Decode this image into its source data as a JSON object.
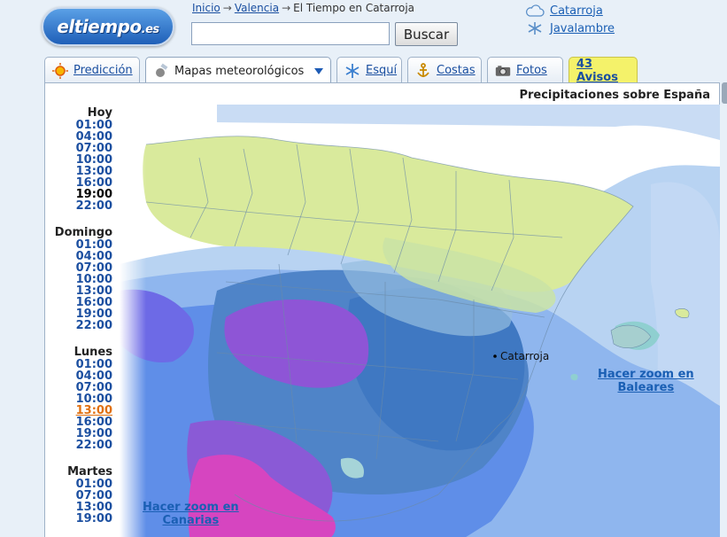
{
  "logo": {
    "main": "eltiempo",
    "suffix": ".es"
  },
  "breadcrumb": {
    "home": "Inicio",
    "arrow": "→",
    "region": "Valencia",
    "current": "El Tiempo en Catarroja"
  },
  "search": {
    "value": "",
    "placeholder": "",
    "button_label": "Buscar"
  },
  "favorites": [
    {
      "label": "Catarroja",
      "icon": "cloud-icon"
    },
    {
      "label": "Javalambre",
      "icon": "snowflake-icon"
    }
  ],
  "tabs": [
    {
      "label": "Predicción",
      "icon": "sun-icon"
    },
    {
      "label": "Mapas meteorológicos",
      "icon": "satellite-icon",
      "active": true
    },
    {
      "label": "Esquí",
      "icon": "snowflake-icon"
    },
    {
      "label": "Costas",
      "icon": "anchor-icon"
    },
    {
      "label": "Fotos",
      "icon": "camera-icon"
    },
    {
      "label": "43 Avisos",
      "icon": ""
    }
  ],
  "map": {
    "title": "Precipitaciones sobre España",
    "city": "Catarroja",
    "zoom_baleares": [
      "Hacer zoom en",
      "Baleares"
    ],
    "zoom_canarias": [
      "Hacer zoom en",
      "Canarias"
    ]
  },
  "schedule": [
    {
      "day": "Hoy",
      "times": [
        "01:00",
        "04:00",
        "07:00",
        "10:00",
        "13:00",
        "16:00",
        "19:00",
        "22:00"
      ],
      "current": "19:00"
    },
    {
      "day": "Domingo",
      "times": [
        "01:00",
        "04:00",
        "07:00",
        "10:00",
        "13:00",
        "16:00",
        "19:00",
        "22:00"
      ]
    },
    {
      "day": "Lunes",
      "times": [
        "01:00",
        "04:00",
        "07:00",
        "10:00",
        "13:00",
        "16:00",
        "19:00",
        "22:00"
      ],
      "selected": "13:00"
    },
    {
      "day": "Martes",
      "times": [
        "01:00",
        "07:00",
        "13:00",
        "19:00"
      ]
    }
  ],
  "colors": {
    "link": "#1a4fa0",
    "selected": "#e07010",
    "avisos_bg": "#f4f26a"
  }
}
